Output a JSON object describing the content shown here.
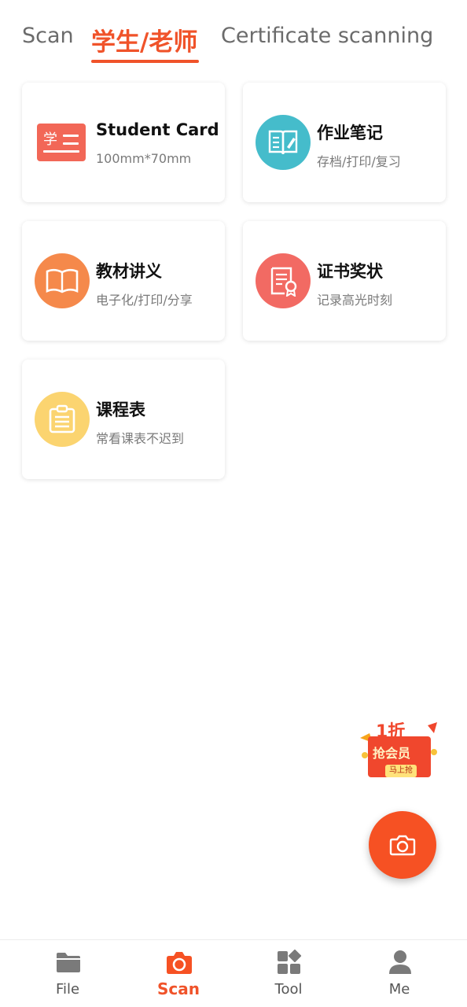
{
  "tabs": [
    {
      "label": "Scan"
    },
    {
      "label": "学生/老师"
    },
    {
      "label": "Certificate scanning"
    }
  ],
  "cards": [
    {
      "title": "Student Card",
      "subtitle": "100mm*70mm",
      "icon": "student-card-icon",
      "color": "#f26757"
    },
    {
      "title": "作业笔记",
      "subtitle": "存档/打印/复习",
      "icon": "notebook-icon",
      "color": "#45bccb"
    },
    {
      "title": "教材讲义",
      "subtitle": "电子化/打印/分享",
      "icon": "open-book-icon",
      "color": "#f5894b"
    },
    {
      "title": "证书奖状",
      "subtitle": "记录高光时刻",
      "icon": "certificate-icon",
      "color": "#f26a63"
    },
    {
      "title": "课程表",
      "subtitle": "常看课表不迟到",
      "icon": "clipboard-icon",
      "color": "#fbd470"
    }
  ],
  "student_card_icon_char": "学",
  "promo": {
    "line1": "1折",
    "line2": "抢会员",
    "button": "马上抢"
  },
  "nav": [
    {
      "label": "File",
      "icon": "folder-icon"
    },
    {
      "label": "Scan",
      "icon": "camera-icon"
    },
    {
      "label": "Tool",
      "icon": "tools-grid-icon"
    },
    {
      "label": "Me",
      "icon": "person-icon"
    }
  ],
  "colors": {
    "accent": "#f0532a",
    "fab": "#f65123"
  }
}
